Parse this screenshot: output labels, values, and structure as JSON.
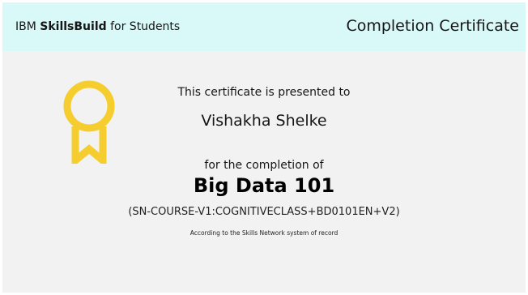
{
  "header": {
    "brand_prefix": "IBM ",
    "brand_bold": "SkillsBuild",
    "brand_suffix": " for Students",
    "title": "Completion Certificate"
  },
  "certificate": {
    "presented_text": "This certificate is presented to",
    "recipient_name": "Vishakha Shelke",
    "completion_text": "for the completion of",
    "course_title": "Big Data 101",
    "course_code": "(SN-COURSE-V1:COGNITIVECLASS+BD0101EN+V2)",
    "record_text": "According to the Skills Network system of record"
  },
  "icons": {
    "badge": "award-ribbon-icon"
  },
  "colors": {
    "header_background": "#d9f8f8",
    "body_background": "#f2f2f2",
    "badge_color": "#f5cd2e"
  }
}
